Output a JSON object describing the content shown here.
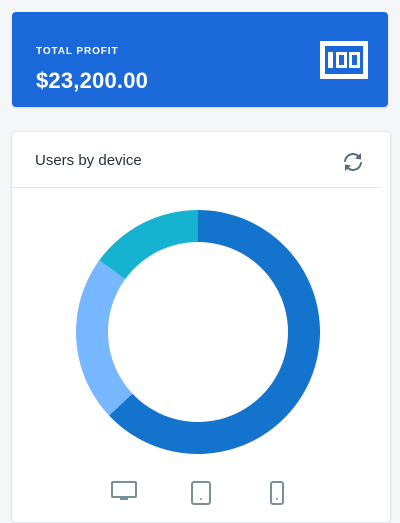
{
  "profit_card": {
    "label": "TOTAL PROFIT",
    "value": "$23,200.00",
    "icon": "money-icon",
    "background_color": "#1a68d9"
  },
  "device_card": {
    "title": "Users by device",
    "refresh_icon": "refresh-icon",
    "device_icons": [
      "desktop-icon",
      "tablet-icon",
      "phone-icon"
    ]
  },
  "chart_data": {
    "type": "pie",
    "variant": "donut",
    "title": "Users by device",
    "slices": [
      {
        "value": 63,
        "color": "#1473cc"
      },
      {
        "value": 22,
        "color": "#77b7ff"
      },
      {
        "value": 15,
        "color": "#15b3d0"
      }
    ]
  }
}
